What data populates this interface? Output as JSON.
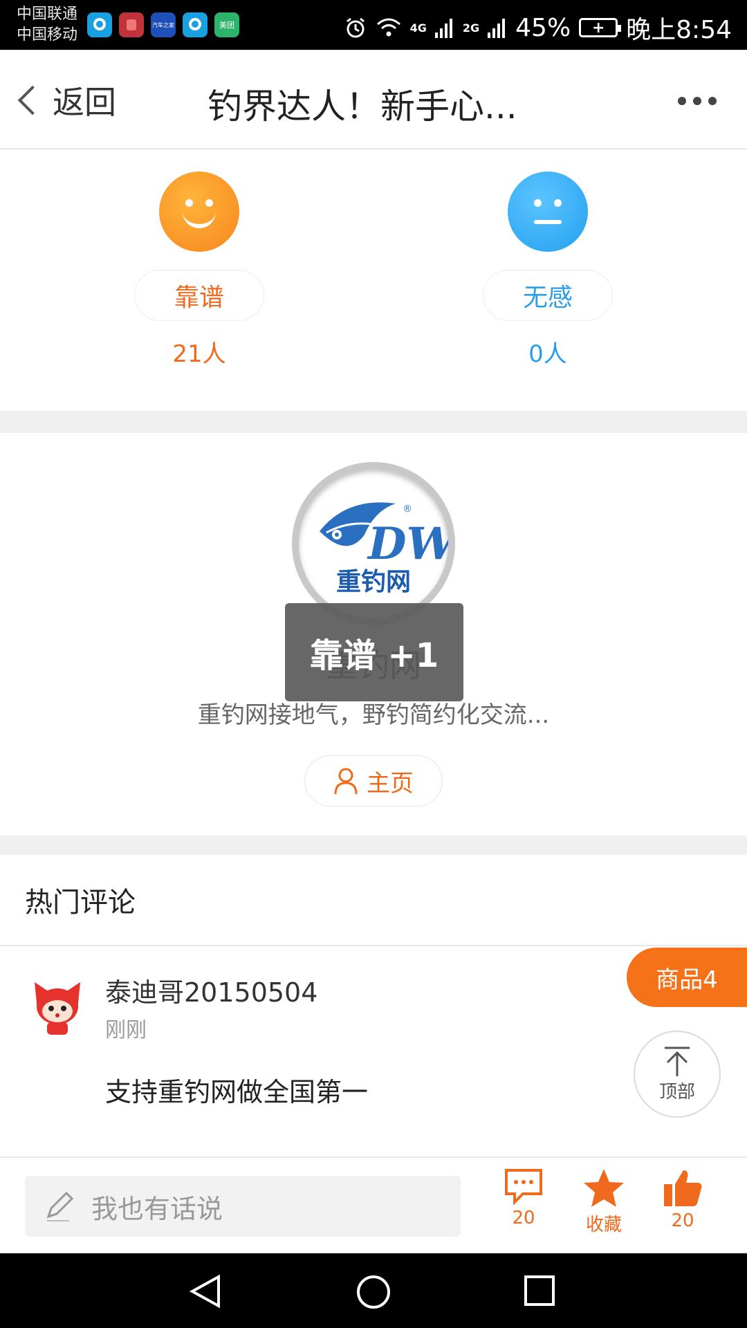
{
  "status_bar": {
    "carrier1": "中国联通",
    "carrier2": "中国移动",
    "apps": [
      {
        "name": "qq",
        "color": "#1aa0e0",
        "label": ""
      },
      {
        "name": "red-app",
        "color": "#c0333a",
        "label": ""
      },
      {
        "name": "autohome",
        "color": "#1f4fb8",
        "label": "汽车之家"
      },
      {
        "name": "qq2",
        "color": "#1aa0e0",
        "label": ""
      },
      {
        "name": "meituan",
        "color": "#2db46b",
        "label": "美团"
      }
    ],
    "net1": "4G",
    "net2": "2G",
    "battery": "45%",
    "time": "晚上8:54"
  },
  "header": {
    "back_label": "返回",
    "title": "钓界达人！新手心..."
  },
  "rating": {
    "good": {
      "label": "靠谱",
      "count": "21人",
      "color": "#f06a1e"
    },
    "neutral": {
      "label": "无感",
      "count": "0人",
      "color": "#2a9ee8"
    }
  },
  "author": {
    "logo_text": "重钓网",
    "logo_initials": "DW",
    "name": "重钓网",
    "desc": "重钓网接地气，野钓简约化交流...",
    "home_label": "主页"
  },
  "toast": {
    "text": "靠谱 +1"
  },
  "comments": {
    "title": "热门评论",
    "items": [
      {
        "user": "泰迪哥20150504",
        "time": "刚刚",
        "text": "支持重钓网做全国第一"
      }
    ]
  },
  "floating": {
    "goods_label": "商品4",
    "top_label": "顶部"
  },
  "bottom_bar": {
    "input_placeholder": "我也有话说",
    "comment_count": "20",
    "favorite_label": "收藏",
    "like_count": "20"
  },
  "colors": {
    "accent": "#f06a1e",
    "blue": "#2a9ee8"
  }
}
